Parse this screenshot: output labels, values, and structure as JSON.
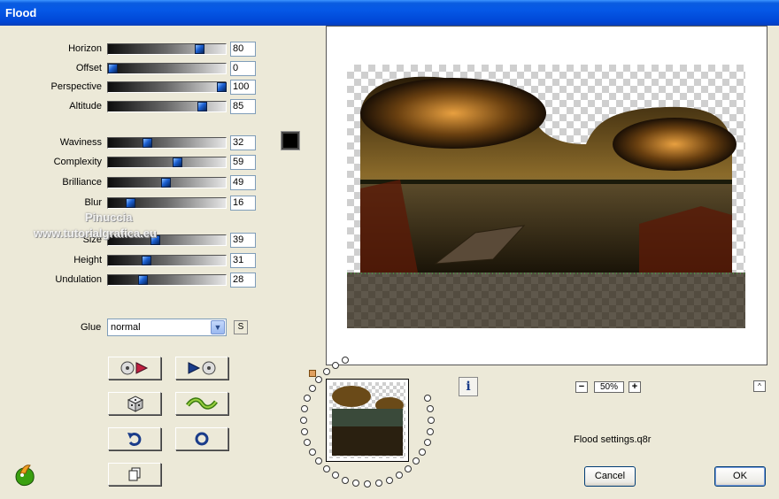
{
  "window": {
    "title": "Flood"
  },
  "sliders": [
    {
      "label": "Horizon",
      "value": "80",
      "fraction": 0.8
    },
    {
      "label": "Offset",
      "value": "0",
      "fraction": 0.0
    },
    {
      "label": "Perspective",
      "value": "100",
      "fraction": 1.0
    },
    {
      "label": "Altitude",
      "value": "85",
      "fraction": 0.82
    },
    {
      "label": "Waviness",
      "value": "32",
      "fraction": 0.32
    },
    {
      "label": "Complexity",
      "value": "59",
      "fraction": 0.59
    },
    {
      "label": "Brilliance",
      "value": "49",
      "fraction": 0.49
    },
    {
      "label": "Blur",
      "value": "16",
      "fraction": 0.16
    },
    {
      "label": "Size",
      "value": "39",
      "fraction": 0.39
    },
    {
      "label": "Height",
      "value": "31",
      "fraction": 0.31
    },
    {
      "label": "Undulation",
      "value": "28",
      "fraction": 0.28
    }
  ],
  "color_swatch": {
    "color": "#000000"
  },
  "glue": {
    "label": "Glue",
    "selected": "normal",
    "s_button": "S"
  },
  "preview": {
    "zoom": "50%",
    "info_icon": "i",
    "up_icon": "^"
  },
  "settings_file": "Flood settings.q8r",
  "buttons": {
    "cancel": "Cancel",
    "ok": "OK"
  },
  "watermark": {
    "line1": "Pinuccia",
    "line2": "www.tutorialgrafica.eu"
  }
}
